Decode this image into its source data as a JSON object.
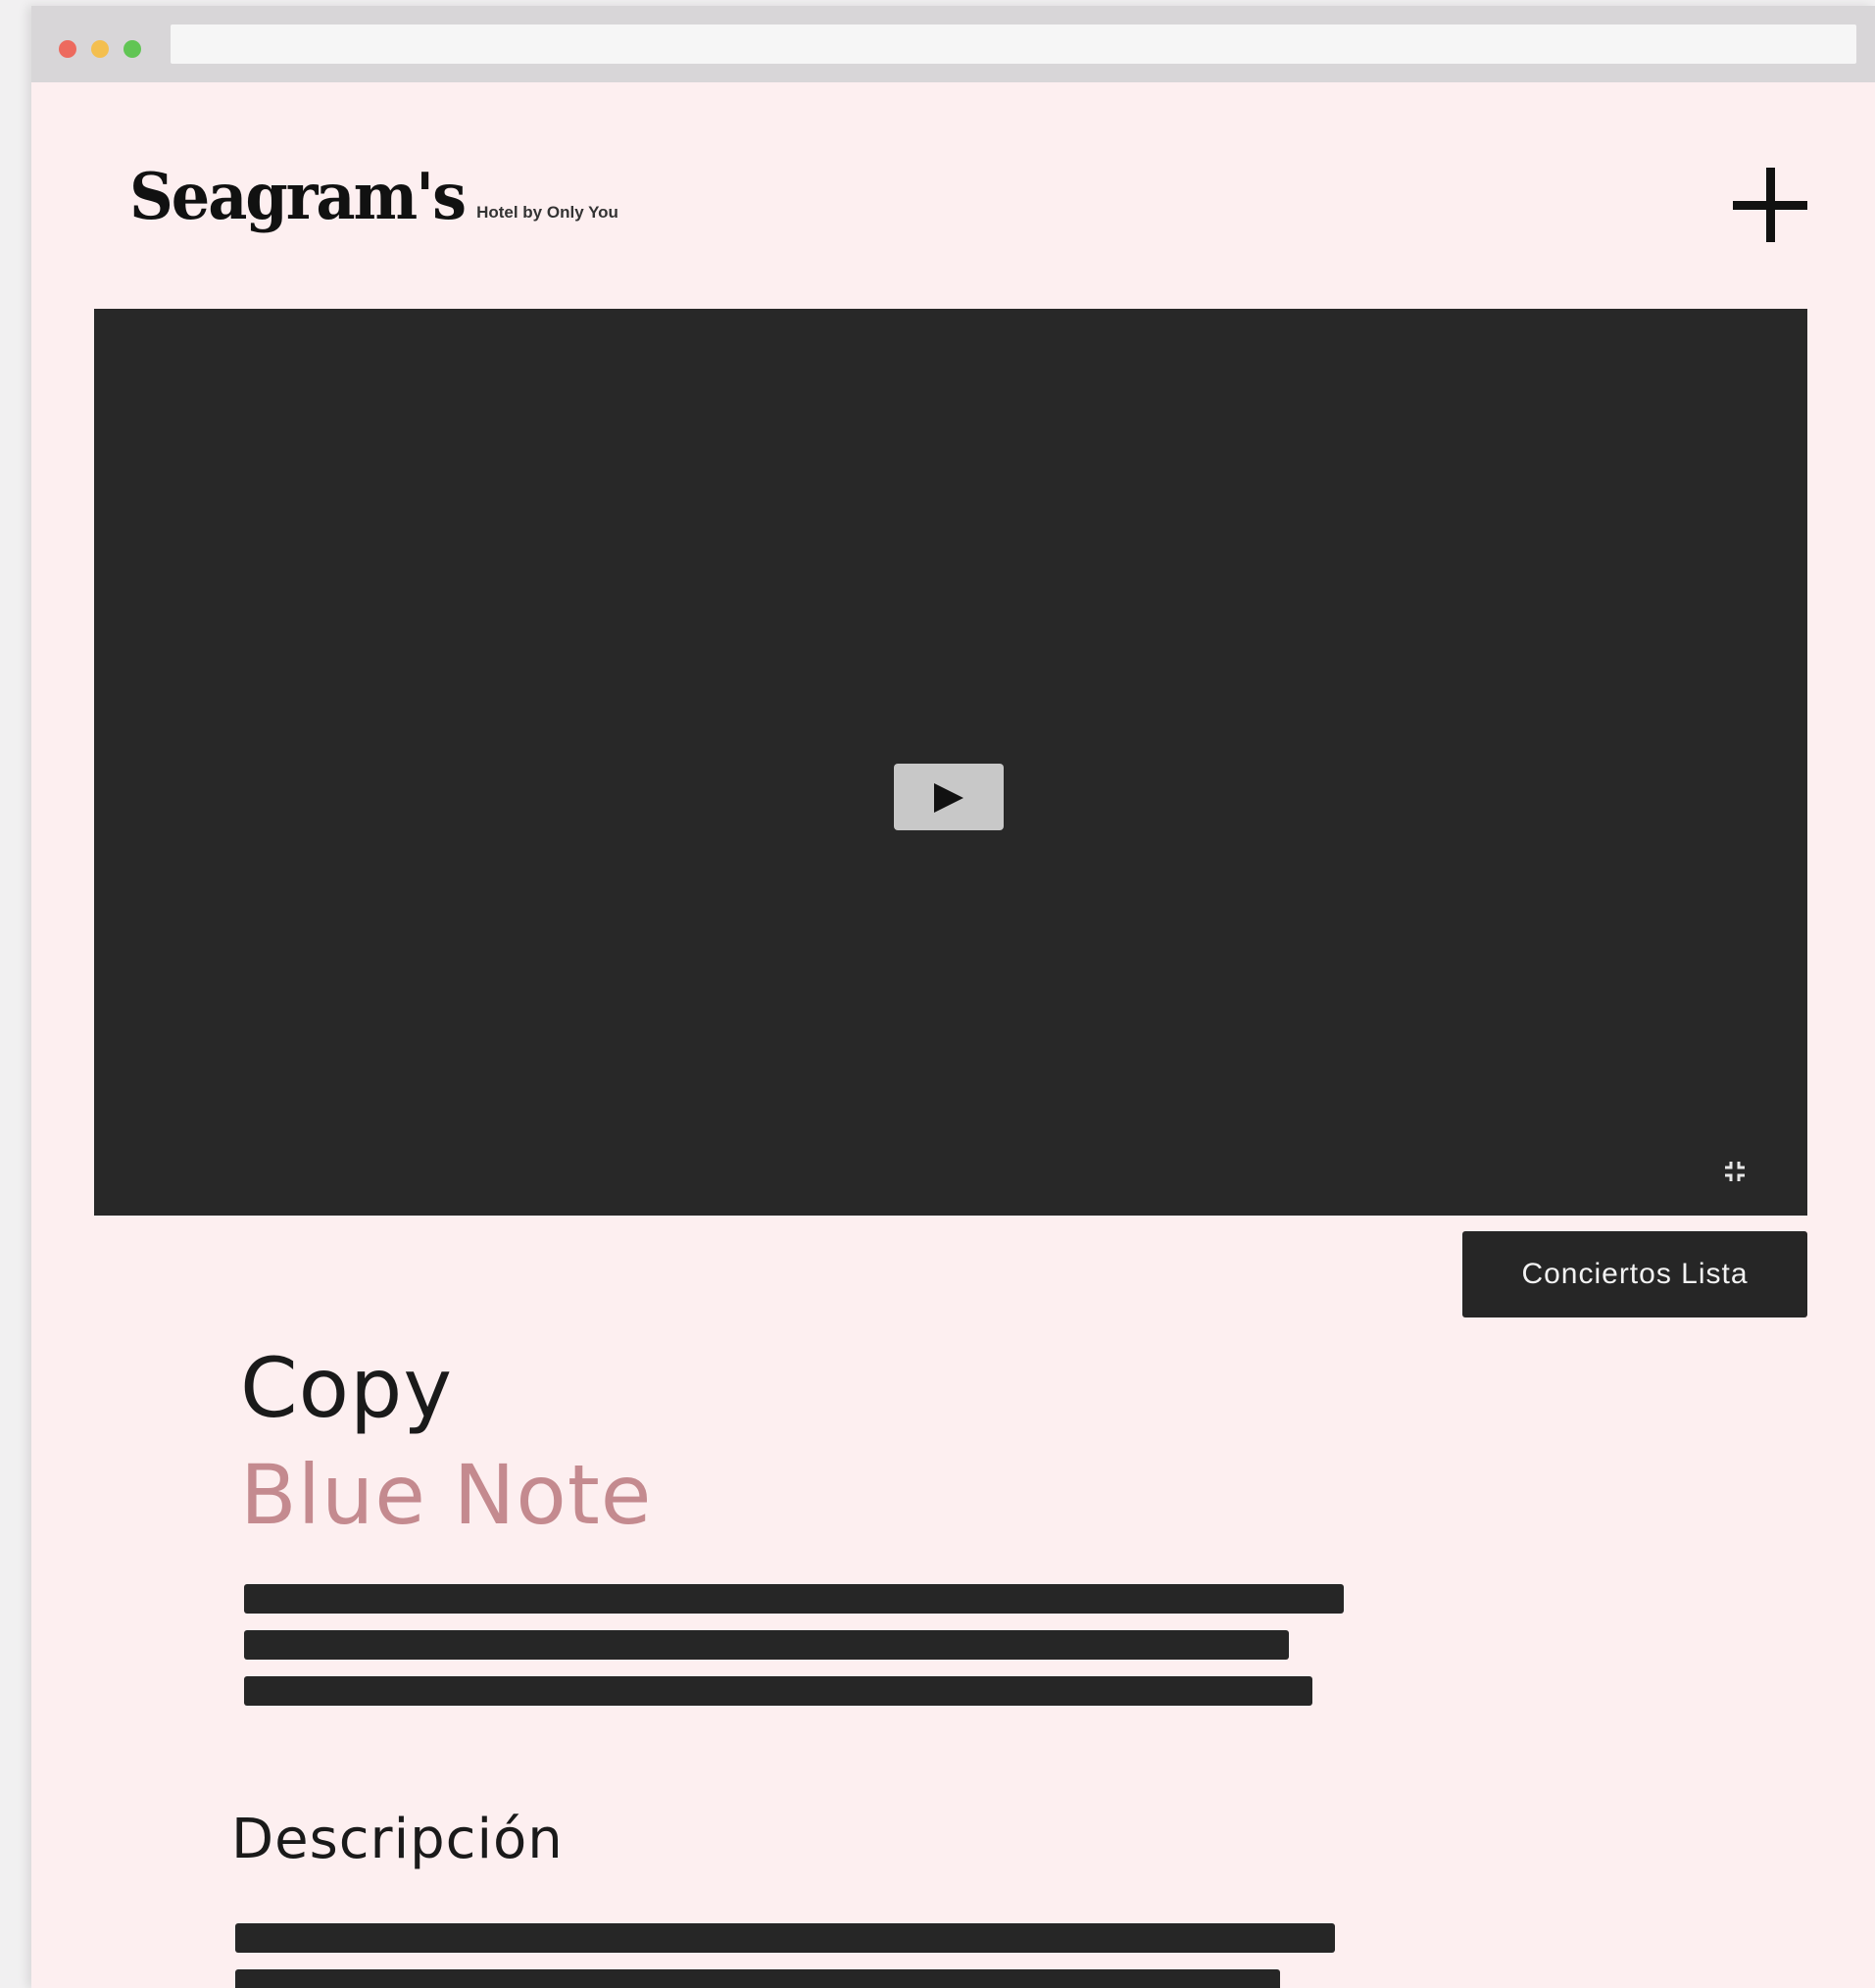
{
  "brand": {
    "name": "Seagram's",
    "tagline": "Hotel by Only You"
  },
  "video": {
    "play_icon": "play-icon",
    "fullscreen_icon": "fullscreen-icon"
  },
  "actions": {
    "list_button_label": "Conciertos Lista"
  },
  "content": {
    "copy_label": "Copy",
    "title": "Blue Note",
    "description_label": "Descripción"
  },
  "colors": {
    "page_background": "#fdeff0",
    "accent_title": "#c48a8f",
    "dark": "#262626"
  }
}
